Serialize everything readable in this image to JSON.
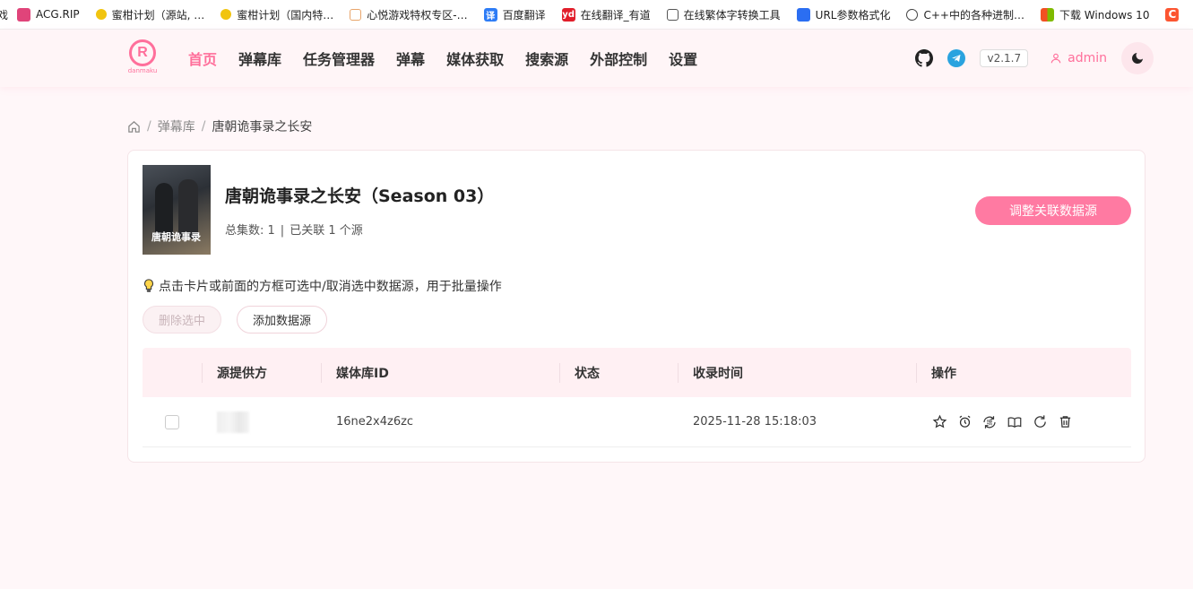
{
  "bookmarks": [
    {
      "label": "戏",
      "icon": "cut-off-icon",
      "color": "#000000"
    },
    {
      "label": "ACG.RIP",
      "icon": "acg-rip-icon",
      "color": "#e0447a"
    },
    {
      "label": "蜜柑计划（源站, …",
      "icon": "mikan-icon",
      "color": "#f1c40f"
    },
    {
      "label": "蜜柑计划（国内特…",
      "icon": "mikan-icon",
      "color": "#f1c40f"
    },
    {
      "label": "心悦游戏特权专区-…",
      "icon": "diamond-icon",
      "color": "#e8a56b"
    },
    {
      "label": "百度翻译",
      "icon": "baidu-translate-icon",
      "color": "#2d7cf6",
      "glyph": "译"
    },
    {
      "label": "在线翻译_有道",
      "icon": "youdao-icon",
      "color": "#e11d2a",
      "glyph": "yd"
    },
    {
      "label": "在线繁体字转换工具",
      "icon": "tools-icon",
      "color": "#555555"
    },
    {
      "label": "URL参数格式化",
      "icon": "cloud-icon",
      "color": "#2b6ef2"
    },
    {
      "label": "C++中的各种进制…",
      "icon": "globe-icon",
      "color": "#444444"
    },
    {
      "label": "下载 Windows 10",
      "icon": "windows-icon",
      "color": "#00a4ef"
    },
    {
      "label": "C",
      "icon": "csdn-icon",
      "color": "#fc5531",
      "glyph": "C"
    }
  ],
  "header": {
    "logo_letter": "R",
    "logo_text": "danmaku",
    "nav": [
      "首页",
      "弹幕库",
      "任务管理器",
      "弹幕",
      "媒体获取",
      "搜索源",
      "外部控制",
      "设置"
    ],
    "active_nav": 0,
    "version": "v2.1.7",
    "user": "admin"
  },
  "breadcrumb": [
    "弹幕库",
    "唐朝诡事录之长安"
  ],
  "show": {
    "poster_text": "唐朝诡事录",
    "title": "唐朝诡事录之长安（Season 03）",
    "episodes_label": "总集数: 1",
    "sources_label": "已关联 1 个源",
    "adjust_button": "调整关联数据源"
  },
  "tip": "点击卡片或前面的方框可选中/取消选中数据源，用于批量操作",
  "buttons": {
    "delete_selected": "删除选中",
    "add_source": "添加数据源"
  },
  "table": {
    "columns": [
      "源提供方",
      "媒体库ID",
      "状态",
      "收录时间",
      "操作"
    ],
    "rows": [
      {
        "provider": "",
        "media_id": "16ne2x4z6zc",
        "status": "",
        "time": "2025-11-28 15:18:03"
      }
    ]
  },
  "colors": {
    "accent": "#ff6f9b",
    "header_bg": "#fff5f7",
    "table_head_bg": "#fff0f3"
  }
}
